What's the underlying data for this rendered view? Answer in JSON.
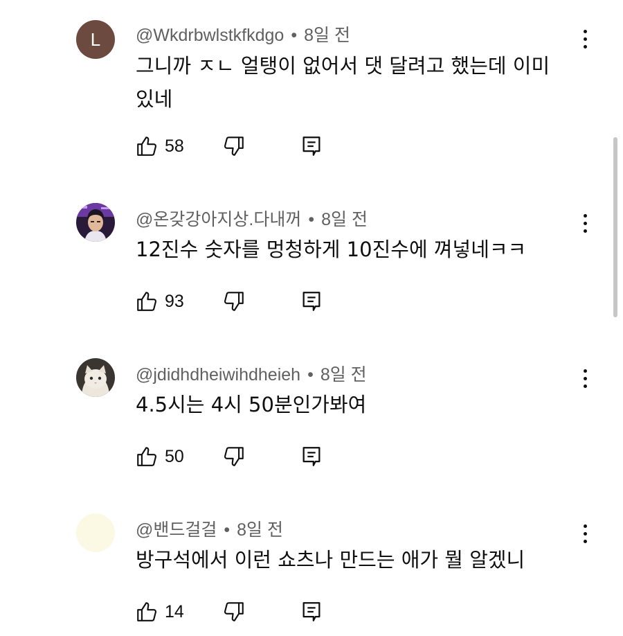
{
  "comments": [
    {
      "avatar_type": "letter",
      "avatar_letter": "L",
      "avatar_color": "#6d4a3f",
      "author": "@Wkdrbwlstkfkdgo",
      "separator": "•",
      "time": "8일 전",
      "text": "그니까 ㅈㄴ 얼탱이 없어서 댓 달려고 했는데 이미\n있네",
      "likes": "58"
    },
    {
      "avatar_type": "photo",
      "avatar_icon": "person-photo-icon",
      "author": "@온갖강아지상.다내꺼",
      "separator": "•",
      "time": "8일 전",
      "text": "12진수 숫자를 멍청하게 10진수에 껴넣네ㅋㅋ",
      "likes": "93"
    },
    {
      "avatar_type": "photo",
      "avatar_icon": "cat-photo-icon",
      "author": "@jdidhdheiwihdheieh",
      "separator": "•",
      "time": "8일 전",
      "text": "4.5시는 4시 50분인가봐여",
      "likes": "50"
    },
    {
      "avatar_type": "plain",
      "avatar_color": "#fbf8e4",
      "author": "@밴드걸걸",
      "separator": "•",
      "time": "8일 전",
      "text": "방구석에서 이런 쇼츠나 만드는 애가 뭘 알겠니",
      "likes": "14"
    }
  ],
  "icons": {
    "like": "thumbs-up-icon",
    "dislike": "thumbs-down-icon",
    "reply": "reply-comment-icon",
    "menu": "more-vert-icon"
  },
  "colors": {
    "text": "#0f0f0f",
    "secondary": "#606060",
    "scrollbar": "#c6c6c6"
  }
}
